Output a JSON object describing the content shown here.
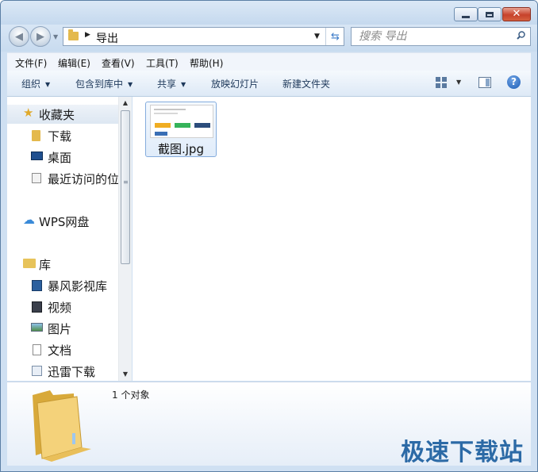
{
  "window": {
    "caption_buttons": [
      "minimize-icon",
      "maximize-icon",
      "close-icon"
    ]
  },
  "address_bar": {
    "path": [
      "导出"
    ]
  },
  "search": {
    "placeholder": "搜索 导出"
  },
  "menu": {
    "items": [
      "文件(F)",
      "编辑(E)",
      "查看(V)",
      "工具(T)",
      "帮助(H)"
    ]
  },
  "toolbar": {
    "organize": "组织",
    "include_in_library": "包含到库中",
    "share": "共享",
    "slideshow": "放映幻灯片",
    "new_folder": "新建文件夹"
  },
  "nav_pane": {
    "favorites": {
      "label": "收藏夹",
      "items": [
        "下载",
        "桌面",
        "最近访问的位置"
      ]
    },
    "wps": "WPS网盘",
    "libraries": {
      "label": "库",
      "items": [
        "暴风影视库",
        "视频",
        "图片",
        "文档",
        "迅雷下载"
      ]
    }
  },
  "files": [
    {
      "name": "截图.jpg"
    }
  ],
  "status": {
    "count": "1 个对象"
  },
  "watermark": "极速下载站",
  "colors": {
    "accent": "#3d7cc9",
    "window_frame": "#cfe0f2",
    "close_button": "#c7422b",
    "watermark": "#2c6aa6"
  }
}
